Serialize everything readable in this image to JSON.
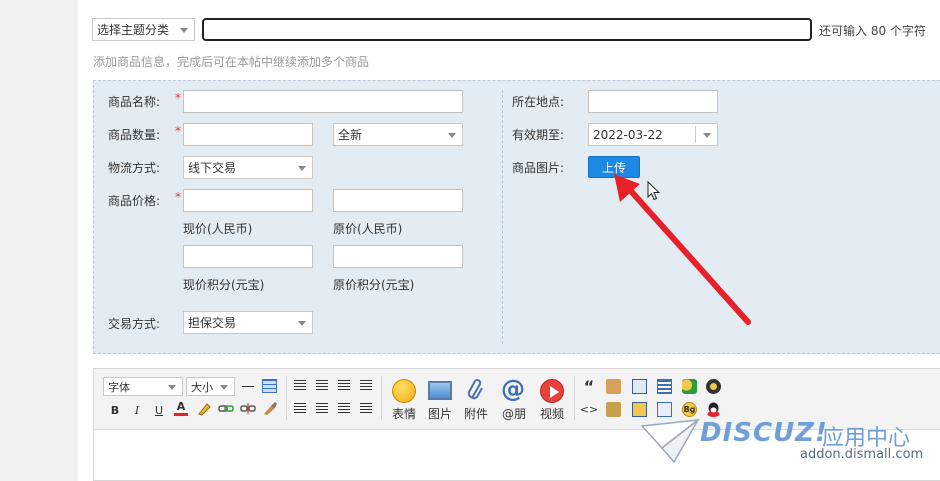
{
  "topic": {
    "category_select": "选择主题分类",
    "title_value": "",
    "char_hint": "还可输入 80 个字符"
  },
  "helper_text": "添加商品信息，完成后可在本帖中继续添加多个商品",
  "form": {
    "name_label": "商品名称:",
    "qty_label": "商品数量:",
    "condition_value": "全新",
    "logistics_label": "物流方式:",
    "logistics_value": "线下交易",
    "price_label": "商品价格:",
    "price_now": "现价(人民币)",
    "price_orig": "原价(人民币)",
    "credit_now": "现价积分(元宝)",
    "credit_orig": "原价积分(元宝)",
    "trade_label": "交易方式:",
    "trade_value": "担保交易",
    "location_label": "所在地点:",
    "expiry_label": "有效期至:",
    "expiry_value": "2022-03-22",
    "image_label": "商品图片:",
    "upload_button": "上传",
    "required_mark": "*"
  },
  "editor": {
    "font_select": "字体",
    "size_select": "大小",
    "bold": "B",
    "italic": "I",
    "underline": "U",
    "fontcolor": "A",
    "quote": "“",
    "code": "<>",
    "emoji_label": "表情",
    "image_label": "图片",
    "attach_label": "附件",
    "at_label": "@朋",
    "video_label": "视频"
  },
  "watermark": {
    "brand": "DISCUZ!",
    "brand_cn": "应用中心",
    "url": "addon.dismall.com"
  },
  "colors": {
    "panel_bg": "#e3ebf3",
    "upload_btn": "#1e88e5",
    "arrow": "#e8202a",
    "required": "#e0353c"
  }
}
